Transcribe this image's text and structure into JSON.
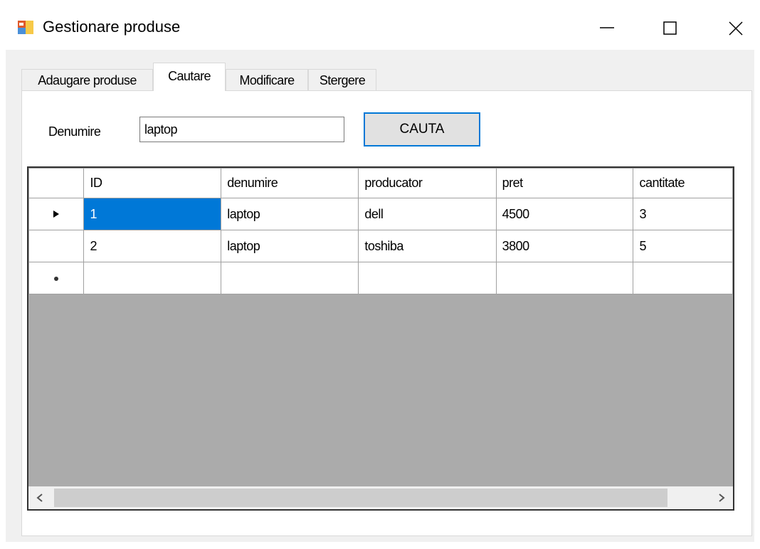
{
  "window": {
    "title": "Gestionare produse",
    "icons": {
      "app": "app-form-icon",
      "minimize": "minimize-icon",
      "maximize": "maximize-icon",
      "close": "close-icon"
    }
  },
  "tabs": [
    {
      "label": "Adaugare produse",
      "active": false
    },
    {
      "label": "Cautare",
      "active": true
    },
    {
      "label": "Modificare",
      "active": false
    },
    {
      "label": "Stergere",
      "active": false
    }
  ],
  "search": {
    "label": "Denumire",
    "value": "laptop",
    "button_label": "CAUTA"
  },
  "grid": {
    "columns": [
      "ID",
      "denumire",
      "producator",
      "pret",
      "cantitate"
    ],
    "rows": [
      {
        "indicator": "current-row-arrow",
        "cells": [
          "1",
          "laptop",
          "dell",
          "4500",
          "3"
        ]
      },
      {
        "indicator": "",
        "cells": [
          "2",
          "laptop",
          "toshiba",
          "3800",
          "5"
        ]
      }
    ],
    "new_row_indicator": "new-row-asterisk",
    "selected_cell": {
      "row": 0,
      "column": "ID"
    }
  },
  "colors": {
    "selection": "#0078d7",
    "button_border": "#0078d7",
    "form_background": "#f0f0f0",
    "grid_empty_area": "#ababab"
  }
}
